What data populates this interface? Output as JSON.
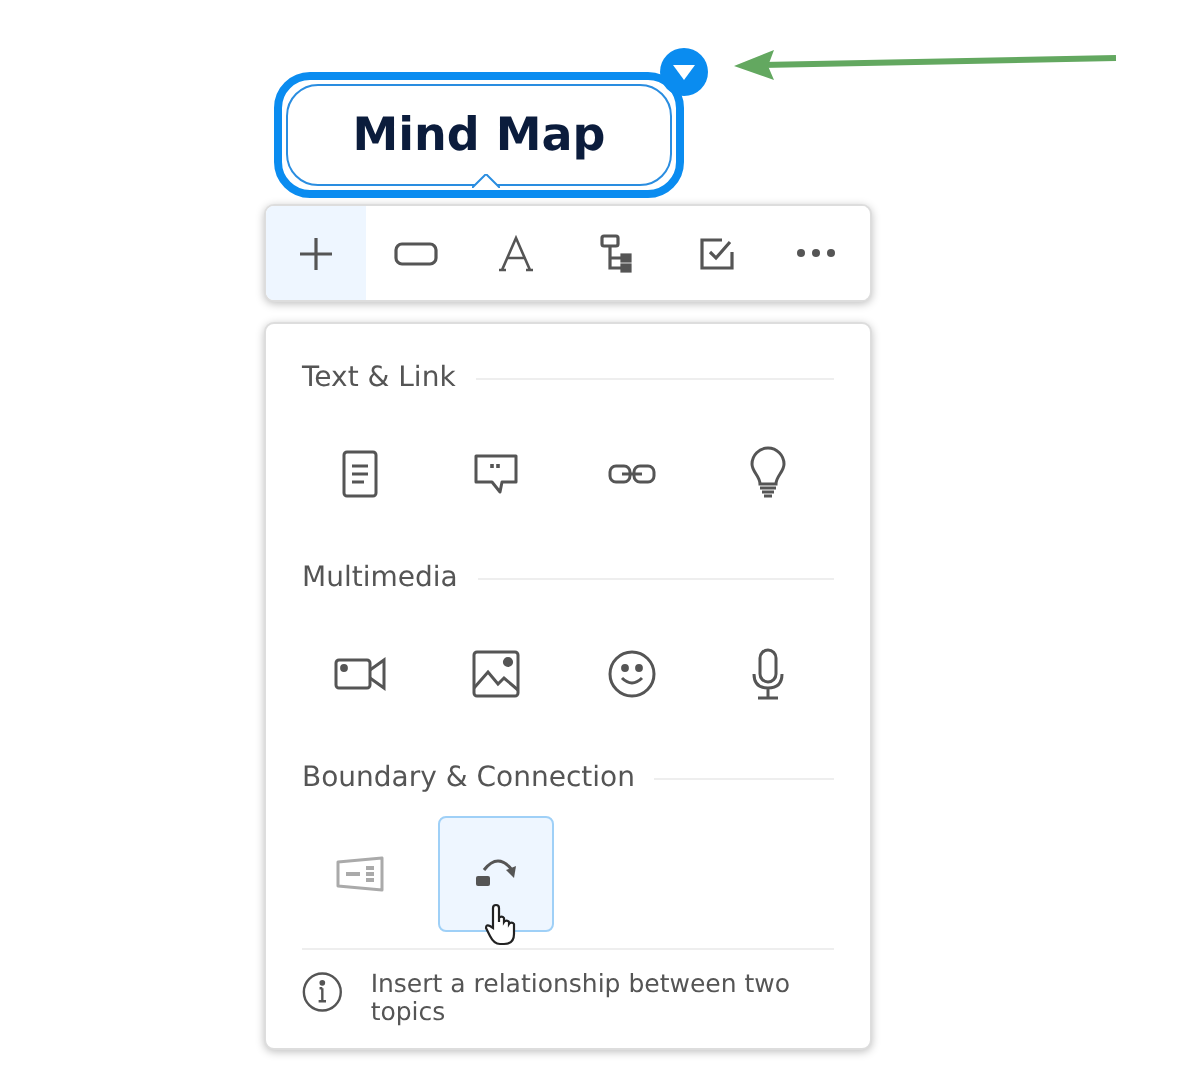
{
  "topic": {
    "title": "Mind Map",
    "selected": true
  },
  "toolbar": [
    {
      "kind": "add",
      "selected": true
    },
    {
      "kind": "shape",
      "selected": false
    },
    {
      "kind": "text",
      "selected": false
    },
    {
      "kind": "structure",
      "selected": false
    },
    {
      "kind": "task",
      "selected": false
    },
    {
      "kind": "more",
      "selected": false
    }
  ],
  "sections": [
    {
      "title": "Text & Link",
      "items": [
        {
          "kind": "note",
          "selected": false,
          "disabled": false
        },
        {
          "kind": "comment",
          "selected": false,
          "disabled": false
        },
        {
          "kind": "link",
          "selected": false,
          "disabled": false
        },
        {
          "kind": "idea",
          "selected": false,
          "disabled": false
        }
      ]
    },
    {
      "title": "Multimedia",
      "items": [
        {
          "kind": "video",
          "selected": false,
          "disabled": false
        },
        {
          "kind": "image",
          "selected": false,
          "disabled": false
        },
        {
          "kind": "emoji",
          "selected": false,
          "disabled": false
        },
        {
          "kind": "audio",
          "selected": false,
          "disabled": false
        }
      ]
    },
    {
      "title": "Boundary & Connection",
      "items": [
        {
          "kind": "boundary",
          "selected": false,
          "disabled": true
        },
        {
          "kind": "relationship",
          "selected": true,
          "disabled": false
        }
      ]
    }
  ],
  "hint": "Insert a relationship between two topics"
}
